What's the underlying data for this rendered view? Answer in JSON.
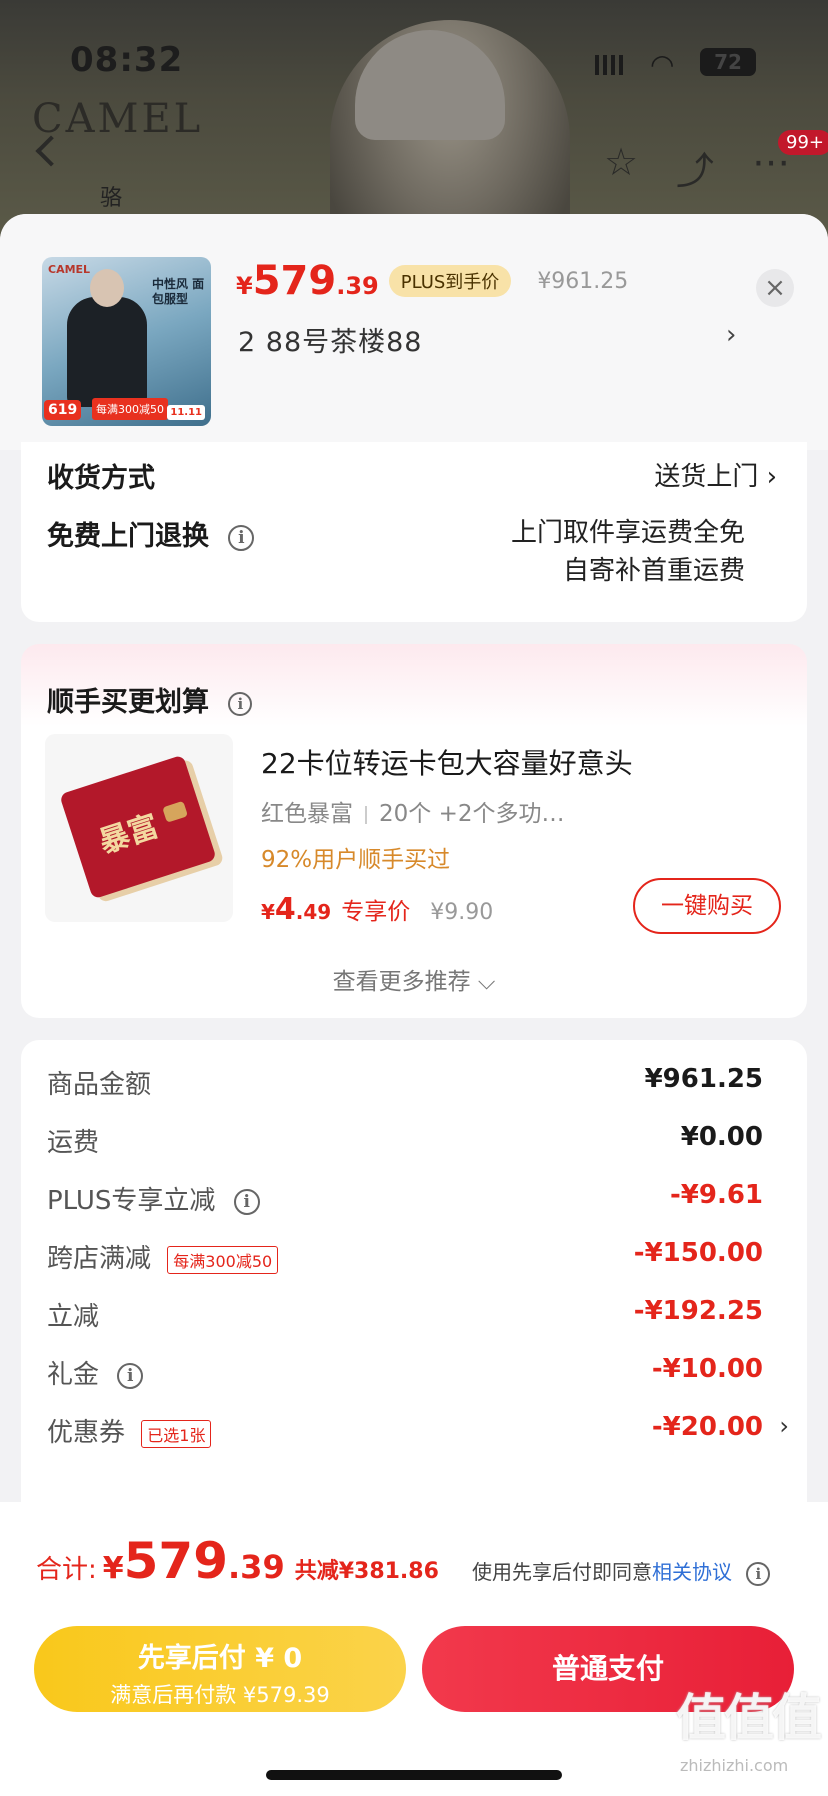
{
  "background": {
    "status_time": "08:32",
    "brand_logo": "CAMEL",
    "brand_sub": "骆",
    "battery": "72",
    "badge": "99+"
  },
  "product": {
    "price_symbol": "¥",
    "price_int": "579",
    "price_dec": ".39",
    "plus_tag": "PLUS到手价",
    "original_price": "¥961.25",
    "spec": "2  88号茶楼88",
    "thumb_logo": "CAMEL",
    "thumb_title": "中性风 面包服型",
    "thumb_price": "619",
    "thumb_promo": "每满300减50",
    "thumb_tag": "11.11"
  },
  "delivery": {
    "method_label": "收货方式",
    "method_value": "送货上门",
    "return_label": "免费上门退换",
    "return_value_1": "上门取件享运费全免",
    "return_value_2": "自寄补首重运费"
  },
  "addon": {
    "title": "顺手买更划算",
    "item_name": "22卡位转运卡包大容量好意头",
    "spec_color": "红色暴富",
    "spec_more": "20个 +2个多功…",
    "stat": "92%用户顺手买过",
    "price_sym": "¥",
    "price_int": "4",
    "price_dec": ".49",
    "price_label": "专享价",
    "price_orig": "¥9.90",
    "buy_button": "一键购买",
    "see_more": "查看更多推荐 ⌵",
    "wallet_text": "暴富"
  },
  "summary": {
    "rows": [
      {
        "label": "商品金额",
        "value": "¥961.25"
      },
      {
        "label": "运费",
        "value": "¥0.00"
      },
      {
        "label": "PLUS专享立减",
        "value": "-¥9.61"
      },
      {
        "label": "跨店满减",
        "tag": "每满300减50",
        "value": "-¥150.00"
      },
      {
        "label": "立减",
        "value": "-¥192.25"
      },
      {
        "label": "礼金",
        "value": "-¥10.00"
      },
      {
        "label": "优惠券",
        "tag": "已选1张",
        "value": "-¥20.00"
      }
    ]
  },
  "bottom": {
    "total_label": "合计:",
    "total_sym": "¥",
    "total_int": "579",
    "total_dec": ".39",
    "total_save": "共减¥381.86",
    "agree_text": "使用先享后付即同意",
    "agree_link": "相关协议",
    "bnpl_line1": "先享后付 ¥ 0",
    "bnpl_line2": "满意后再付款 ¥579.39",
    "pay_button": "普通支付",
    "watermark": "值值值",
    "watermark_sub": "zhizhizhi.com"
  },
  "colors": {
    "accent_red": "#e4251b",
    "plus_gold": "#f8e2a8",
    "bnpl_yellow": "#f9c81b",
    "link_blue": "#2f6fd6"
  }
}
